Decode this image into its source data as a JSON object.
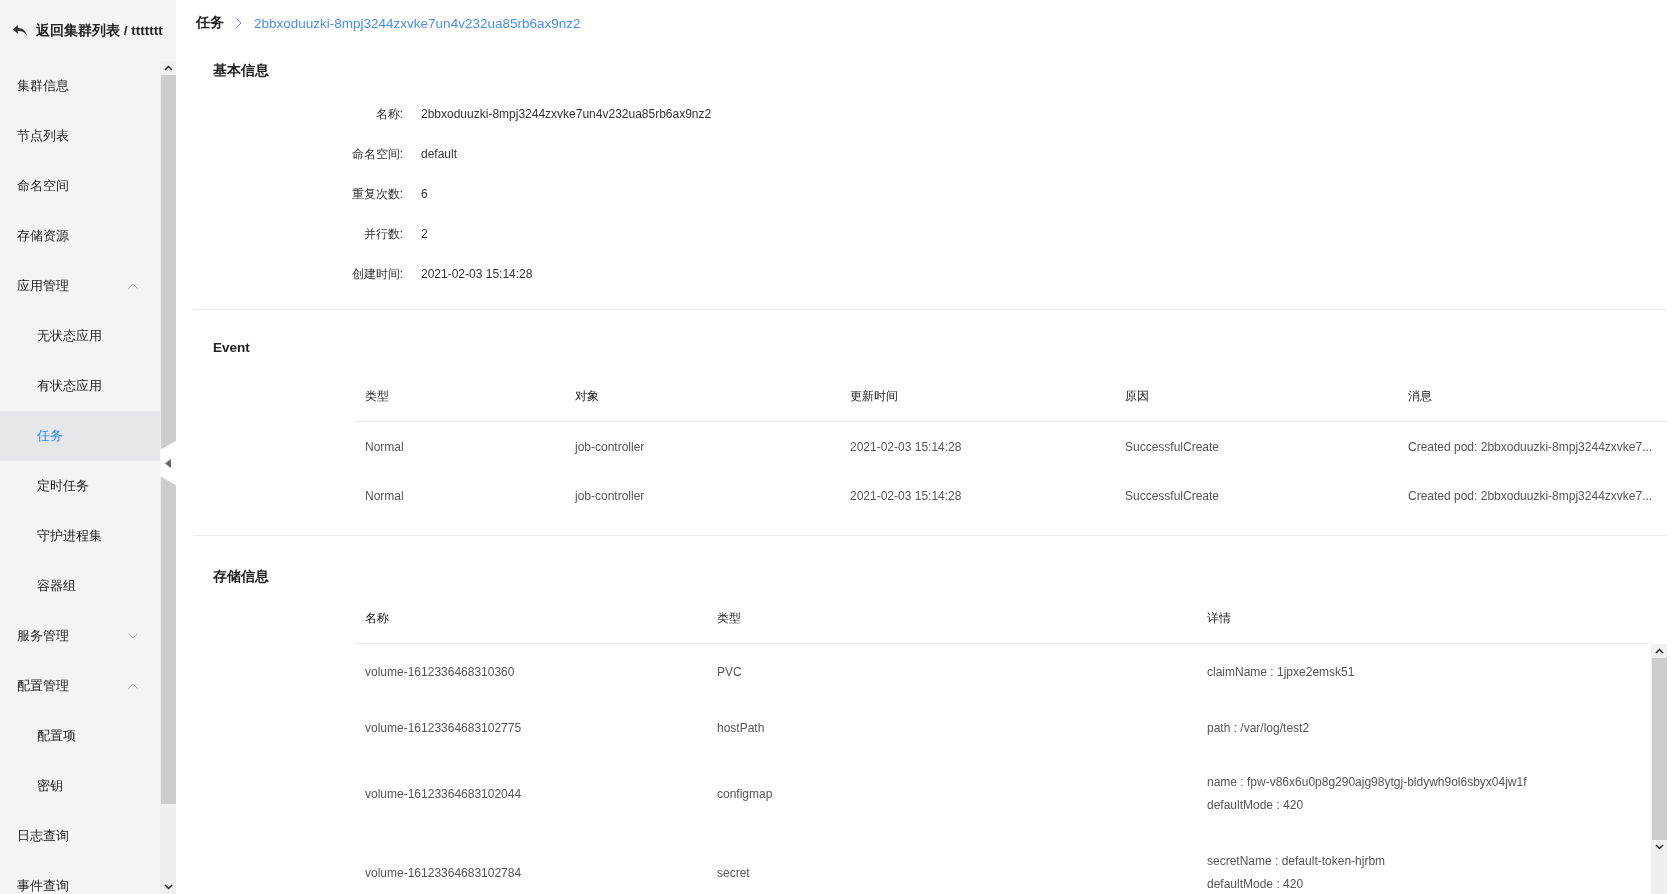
{
  "sidebar": {
    "back_label": "返回集群列表 / ttttttt",
    "items": [
      {
        "label": "集群信息",
        "selected": false
      },
      {
        "label": "节点列表",
        "selected": false
      },
      {
        "label": "命名空间",
        "selected": false
      },
      {
        "label": "存储资源",
        "selected": false
      },
      {
        "label": "应用管理",
        "expanded": true,
        "children": [
          {
            "label": "无状态应用",
            "selected": false
          },
          {
            "label": "有状态应用",
            "selected": false
          },
          {
            "label": "任务",
            "selected": true
          },
          {
            "label": "定时任务",
            "selected": false
          },
          {
            "label": "守护进程集",
            "selected": false
          },
          {
            "label": "容器组",
            "selected": false
          }
        ]
      },
      {
        "label": "服务管理",
        "expanded": false
      },
      {
        "label": "配置管理",
        "expanded": true,
        "children": [
          {
            "label": "配置项",
            "selected": false
          },
          {
            "label": "密钥",
            "selected": false
          }
        ]
      },
      {
        "label": "日志查询",
        "selected": false
      },
      {
        "label": "事件查询",
        "selected": false
      }
    ]
  },
  "breadcrumb": [
    "任务",
    "2bbxoduuzki-8mpj3244zxvke7un4v232ua85rb6ax9nz2"
  ],
  "basic_info": {
    "title": "基本信息",
    "fields": [
      {
        "label": "名称:",
        "value": "2bbxoduuzki-8mpj3244zxvke7un4v232ua85rb6ax9nz2"
      },
      {
        "label": "命名空间:",
        "value": "default"
      },
      {
        "label": "重复次数:",
        "value": "6"
      },
      {
        "label": "并行数:",
        "value": "2"
      },
      {
        "label": "创建时间:",
        "value": "2021-02-03 15:14:28"
      }
    ]
  },
  "events": {
    "title": "Event",
    "columns": [
      "类型",
      "对象",
      "更新时间",
      "原因",
      "消息"
    ],
    "rows": [
      [
        "Normal",
        "job-controller",
        "2021-02-03 15:14:28",
        "SuccessfulCreate",
        "Created pod: 2bbxoduuzki-8mpj3244zxvke7..."
      ],
      [
        "Normal",
        "job-controller",
        "2021-02-03 15:14:28",
        "SuccessfulCreate",
        "Created pod: 2bbxoduuzki-8mpj3244zxvke7..."
      ]
    ]
  },
  "storage": {
    "title": "存储信息",
    "columns": [
      "名称",
      "类型",
      "详情"
    ],
    "rows": [
      {
        "name": "volume-1612336468310360",
        "type": "PVC",
        "details": [
          "claimName : 1jpxe2emsk51"
        ]
      },
      {
        "name": "volume-16123364683102775",
        "type": "hostPath",
        "details": [
          "path : /var/log/test2"
        ]
      },
      {
        "name": "volume-16123364683102044",
        "type": "configmap",
        "details": [
          "name : fpw-v86x6u0p8g290ajg98ytgj-bldywh9ol6sbyx04jw1f",
          "defaultMode : 420"
        ]
      },
      {
        "name": "volume-16123364683102784",
        "type": "secret",
        "details": [
          "secretName : default-token-hjrbm",
          "defaultMode : 420"
        ]
      }
    ]
  }
}
